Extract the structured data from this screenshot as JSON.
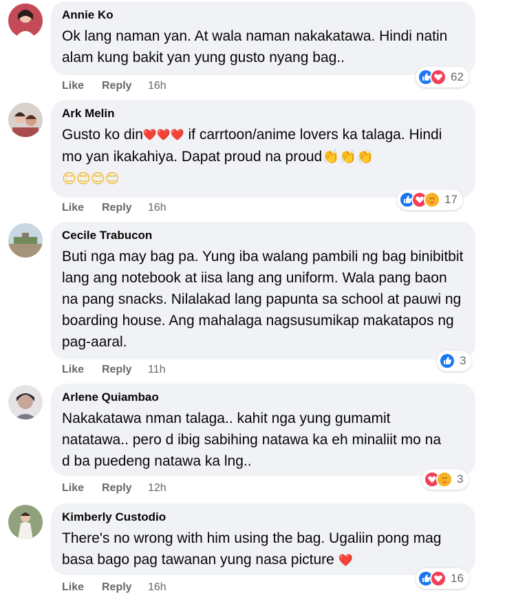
{
  "comments": [
    {
      "author": "Annie Ko",
      "text": "Ok lang naman yan. At wala naman nakakatawa. Hindi natin alam kung bakit yan yung gusto nyang bag..",
      "like_label": "Like",
      "reply_label": "Reply",
      "time": "16h",
      "reactions": [
        "like",
        "love"
      ],
      "reaction_count": "62"
    },
    {
      "author": "Ark Melin",
      "text_parts": [
        "Gusto ko din",
        " if carrtoon/anime lovers ka talaga. Hindi mo yan ikakahiya. Dapat proud na proud"
      ],
      "like_label": "Like",
      "reply_label": "Reply",
      "time": "16h",
      "reactions": [
        "like",
        "love",
        "care"
      ],
      "reaction_count": "17"
    },
    {
      "author": "Cecile Trabucon",
      "text": "Buti nga may bag pa. Yung iba walang pambili ng bag binibitbit lang ang notebook at iisa lang ang uniform. Wala pang baon na pang snacks. Nilalakad lang papunta sa school at pauwi ng boarding house. Ang mahalaga nagsusumikap makatapos ng pag-aaral.",
      "like_label": "Like",
      "reply_label": "Reply",
      "time": "11h",
      "reactions": [
        "like"
      ],
      "reaction_count": "3"
    },
    {
      "author": "Arlene Quiambao",
      "text": "Nakakatawa nman talaga.. kahit nga yung gumamit natatawa.. pero d ibig sabihing natawa ka eh minaliit mo na d ba puedeng natawa ka lng..",
      "like_label": "Like",
      "reply_label": "Reply",
      "time": "12h",
      "reactions": [
        "love",
        "care"
      ],
      "reaction_count": "3"
    },
    {
      "author": "Kimberly Custodio",
      "text": "There's no wrong with him using the bag. Ugaliin pong mag basa bago pag tawanan yung nasa picture",
      "like_label": "Like",
      "reply_label": "Reply",
      "time": "16h",
      "reactions": [
        "like",
        "love"
      ],
      "reaction_count": "16"
    }
  ],
  "colors": {
    "bubble": "#f0f2f5",
    "like_blue": "#1877f2",
    "love_red": "#f33e58",
    "care_yellow": "#f7b125",
    "meta_gray": "#65676b"
  }
}
